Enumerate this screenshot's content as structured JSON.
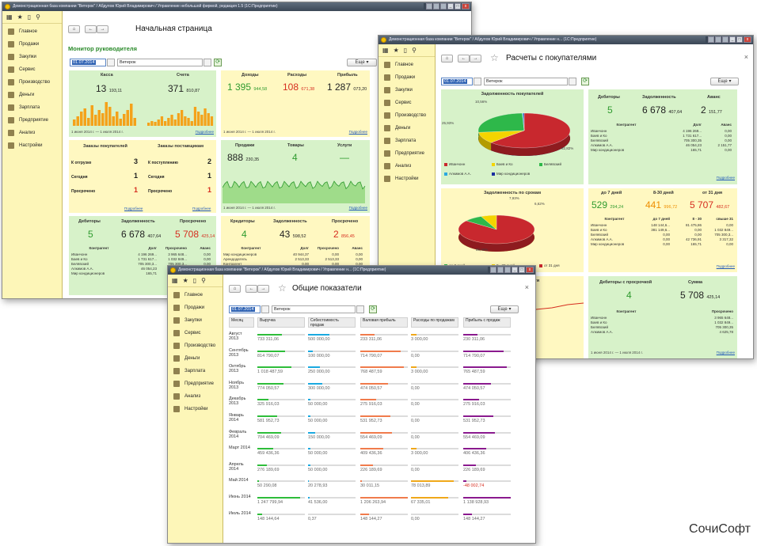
{
  "app_title": "Демонстрационная база компании \"Ветерок\" / Абдулов Юрий Владимирович / Управление небольшой фирмой, редакция 1.5 (1С:Предприятие)",
  "app_title_short": "Демонстрационная база компании \"Ветерок\" / Абдулов Юрий Владимирович / Управление н... (1С:Предприятие)",
  "nav": [
    "Главное",
    "Продажи",
    "Закупки",
    "Сервис",
    "Производство",
    "Деньги",
    "Зарплата",
    "Предприятие",
    "Анализ",
    "Настройки"
  ],
  "common": {
    "date": "01.07.2014",
    "org": "Ветерок",
    "more": "Еще",
    "more_arrow": "▾",
    "details": "Подробнее",
    "star": "☆",
    "close": "×",
    "home": "⌂",
    "back": "←",
    "fwd": "→"
  },
  "w1": {
    "title": "Начальная страница",
    "section": "Монитор руководителя",
    "kassa": {
      "label": "Касса",
      "value": "13",
      "dec": "193,11"
    },
    "scheta": {
      "label": "Счета",
      "value": "371",
      "dec": "810,87"
    },
    "period": "1 июня 2014 г. — 1 июля 2014 г.",
    "dohody": {
      "label": "Доходы",
      "value": "1 395",
      "dec": "944,58"
    },
    "rashody": {
      "label": "Расходы",
      "value": "108",
      "dec": "671,38"
    },
    "pribyl": {
      "label": "Прибыль",
      "value": "1 287",
      "dec": "073,20"
    },
    "zakazy_pok": "Заказы покупателей",
    "zakazy_post": "Заказы поставщикам",
    "zp_rows": [
      {
        "l": "К отгрузке",
        "v": "3"
      },
      {
        "l": "Сегодня",
        "v": "1"
      },
      {
        "l": "Просрочено",
        "v": "1"
      }
    ],
    "zs_rows": [
      {
        "l": "К поступлению",
        "v": "2"
      },
      {
        "l": "Сегодня",
        "v": "1"
      },
      {
        "l": "Просрочено",
        "v": "1"
      }
    ],
    "prodazhi": {
      "label": "Продажи",
      "value": "888",
      "dec": "230,35"
    },
    "tovary": {
      "label": "Товары",
      "value": "4"
    },
    "uslugi": {
      "label": "Услуги",
      "value": "—"
    },
    "debitory": {
      "label": "Дебиторы",
      "value": "5"
    },
    "zadolzh": {
      "label": "Задолженность",
      "value": "6 678",
      "dec": "407,64"
    },
    "prosr": {
      "label": "Просрочено",
      "value": "5 708",
      "dec": "425,14"
    },
    "deb_head": [
      "Контрагент",
      "Долг",
      "Просрочено",
      "Аванс"
    ],
    "deb_rows": [
      [
        "Иванчонн",
        "4 196 269...",
        "3 965 648...",
        "0,00"
      ],
      [
        "Баев и Ко",
        "1 731 617...",
        "1 032 849...",
        "0,00"
      ],
      [
        "Белявский",
        "705 300,3...",
        "705 300,3...",
        "0,00"
      ],
      [
        "Алкимов А.А.",
        "46 054,23",
        "0,00",
        "2 151,77"
      ],
      [
        "Мир кондиционеров",
        "165,71",
        "0,00",
        "0,00"
      ]
    ],
    "kreditory": {
      "label": "Кредиторы",
      "value": "4"
    },
    "kzad": {
      "label": "Задолженность",
      "value": "43",
      "dec": "598,52"
    },
    "kprosr": {
      "label": "Просрочено",
      "value": "2",
      "dec": "856,45"
    },
    "kr_head": [
      "Контрагент",
      "Долг",
      "Просрочено",
      "Аванс"
    ],
    "kr_rows": [
      [
        "Мир кондиционеров",
        "40 944,37",
        "0,00",
        "0,00"
      ],
      [
        "Арендодатель",
        "2 513,33",
        "2 513,33",
        "0,00"
      ],
      [
        "Контрагент",
        "0,00",
        "0,00",
        "0,00"
      ],
      [
        "Прочие",
        "140,82",
        "0,00",
        "0,00"
      ]
    ]
  },
  "w2": {
    "title": "Расчеты с покупателями",
    "pie1": {
      "label": "Задолженность покупателей",
      "p1": "10,56%",
      "p2": "25,93%",
      "p3": "62,82%"
    },
    "pie1_legend": [
      "Иванчонн",
      "Баев и Ко",
      "Белявский",
      "Алкимов А.А.",
      "Мир кондиционеров"
    ],
    "debitory": {
      "label": "Дебиторы",
      "value": "5"
    },
    "zadolzh": {
      "label": "Задолженность",
      "value": "6 678",
      "dec": "407,64"
    },
    "avans": {
      "label": "Аванс",
      "value": "2",
      "dec": "151,77"
    },
    "t1_head": [
      "Контрагент",
      "Долг",
      "Аванс"
    ],
    "t1_rows": [
      [
        "Иванчонн",
        "4 196 269...",
        "0,00"
      ],
      [
        "Баев и Ко",
        "1 731 617...",
        "0,00"
      ],
      [
        "Белявский",
        "705 300,35",
        "0,00"
      ],
      [
        "Алкимов А.А.",
        "46 054,23",
        "2 151,77"
      ],
      [
        "Мир кондиционеров",
        "165,71",
        "0,00"
      ]
    ],
    "pie2": {
      "label": "Задолженность по срокам",
      "p1": "7,93%",
      "p2": "6,62%",
      "p3": "85,46%"
    },
    "pie2_legend": [
      "до 7 дней",
      "8 - 30 дней",
      "от 31 дня"
    ],
    "d7": {
      "label": "до 7 дней",
      "value": "529",
      "dec": "294,24"
    },
    "d30": {
      "label": "8-30 дней",
      "value": "441",
      "dec": "996,72"
    },
    "d31": {
      "label": "от 31 дня",
      "value": "5 707",
      "dec": "482,67"
    },
    "t2_head": [
      "Контрагент",
      "до 7 дней",
      "8 - 30",
      "свыше 31"
    ],
    "t2_rows": [
      [
        "Иванчонн",
        "148 144,6...",
        "81 475,86",
        "0,00"
      ],
      [
        "Баев и Ко",
        "381 149,6...",
        "0,00",
        "1 032 849..."
      ],
      [
        "Белявский",
        "0,00",
        "0,00",
        "705 300,3..."
      ],
      [
        "Алкимов А.А.",
        "0,00",
        "42 736,91",
        "3 317,32"
      ],
      [
        "Мир кондиционеров",
        "0,00",
        "165,71",
        "0,00"
      ]
    ],
    "deb_prosr": {
      "label": "Дебиторы с просрочкой",
      "value": "4"
    },
    "summa": {
      "label": "Сумма",
      "value": "5 708",
      "dec": "425,14"
    },
    "t3_head": [
      "Контрагент",
      "Просрочено"
    ],
    "t3_rows": [
      [
        "Иванчонн",
        "3 965 648..."
      ],
      [
        "Баев и Ко",
        "1 032 849..."
      ],
      [
        "Белявский",
        "705 300,35"
      ],
      [
        "Алкимов А.А.",
        "4 625,78"
      ]
    ],
    "period": "1 июня 2014 г. — 1 июля 2014 г.",
    "cut": "ти"
  },
  "w3": {
    "title": "Общие показатели",
    "cols": [
      "Месяц",
      "Выручка",
      "Себестоимость продаж",
      "Валовая прибыль",
      "Расходы по продажам",
      "Прибыль с продаж"
    ],
    "rows": [
      {
        "m": "Август 2013",
        "v": [
          "733 311,06",
          "500 000,00",
          "233 311,06",
          "3 000,00",
          "230 311,06"
        ],
        "f": [
          0.52,
          0.45,
          0.3,
          0.12,
          0.3
        ]
      },
      {
        "m": "Сентябрь 2013",
        "v": [
          "814 790,07",
          "100 000,00",
          "714 790,07",
          "0,00",
          "714 790,07"
        ],
        "f": [
          0.58,
          0.1,
          0.85,
          0,
          0.85
        ]
      },
      {
        "m": "Октябрь 2013",
        "v": [
          "1 018 487,59",
          "250 000,00",
          "768 487,59",
          "3 000,00",
          "765 487,59"
        ],
        "f": [
          0.72,
          0.25,
          0.92,
          0.12,
          0.91
        ]
      },
      {
        "m": "Ноябрь 2013",
        "v": [
          "774 050,57",
          "300 000,00",
          "474 050,57",
          "0,00",
          "474 050,57"
        ],
        "f": [
          0.55,
          0.3,
          0.58,
          0,
          0.58
        ]
      },
      {
        "m": "Декабрь 2013",
        "v": [
          "325 916,03",
          "50 000,00",
          "275 916,03",
          "0,00",
          "275 916,03"
        ],
        "f": [
          0.24,
          0.05,
          0.34,
          0,
          0.34
        ]
      },
      {
        "m": "Январь 2014",
        "v": [
          "581 952,73",
          "50 000,00",
          "531 952,73",
          "0,00",
          "531 952,73"
        ],
        "f": [
          0.42,
          0.05,
          0.64,
          0,
          0.64
        ]
      },
      {
        "m": "Февраль 2014",
        "v": [
          "704 469,09",
          "150 000,00",
          "554 469,09",
          "0,00",
          "554 469,09"
        ],
        "f": [
          0.5,
          0.15,
          0.66,
          0,
          0.66
        ]
      },
      {
        "m": "Март 2014",
        "v": [
          "459 436,36",
          "50 000,00",
          "409 436,36",
          "3 000,00",
          "406 436,36"
        ],
        "f": [
          0.33,
          0.05,
          0.49,
          0.12,
          0.49
        ]
      },
      {
        "m": "Апрель 2014",
        "v": [
          "276 189,69",
          "50 000,00",
          "226 189,69",
          "0,00",
          "226 189,69"
        ],
        "f": [
          0.2,
          0.05,
          0.27,
          0,
          0.27
        ]
      },
      {
        "m": "Май 2014",
        "v": [
          "50 290,08",
          "20 278,93",
          "30 011,15",
          "78 013,89",
          "-48 002,74"
        ],
        "f": [
          0.04,
          0.02,
          0.04,
          0.9,
          0.06
        ]
      },
      {
        "m": "Июнь 2014",
        "v": [
          "1 247 799,94",
          "41 536,00",
          "1 206 263,94",
          "67 335,01",
          "1 138 928,93"
        ],
        "f": [
          0.9,
          0.04,
          1.0,
          0.78,
          1.0
        ]
      },
      {
        "m": "Июль 2014",
        "v": [
          "148 144,64",
          "0,37",
          "148 144,27",
          "0,00",
          "148 144,27"
        ],
        "f": [
          0.1,
          0,
          0.18,
          0,
          0.18
        ]
      }
    ],
    "colors": [
      "#2ebd3a",
      "#1aa9e0",
      "#f07b4c",
      "#f0a81a",
      "#8a1a8e"
    ]
  },
  "brand": "СочиСофт"
}
